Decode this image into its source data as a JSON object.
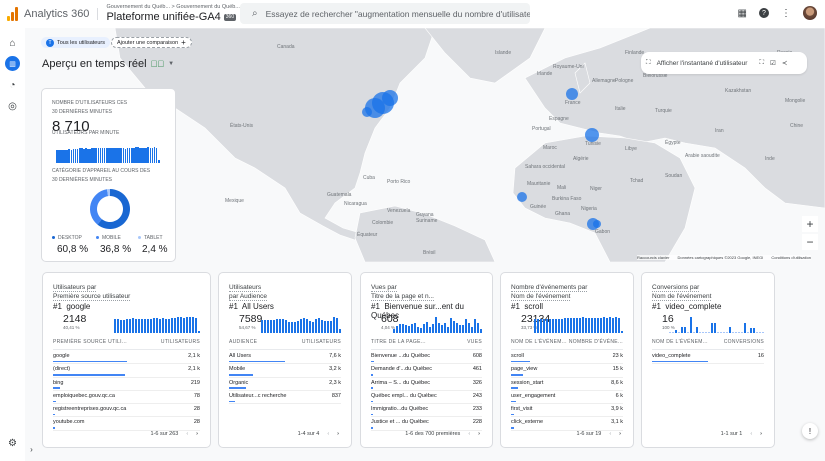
{
  "header": {
    "app_name": "Analytics 360",
    "breadcrumb": "Gouvernement du Québ... > Gouvernement du Québ...",
    "property": "Plateforme unifiée-GA4",
    "property_badge": "360",
    "search_placeholder": "Essayez de rechercher \"augmentation mensuelle du nombre d'utilisateurs..."
  },
  "filters": {
    "segment_badge": "T",
    "segment": "Tous les utilisateurs",
    "add_comparison": "Ajouter une comparaison"
  },
  "page_title": "Aperçu en temps réel",
  "map": {
    "snapshot_label": "Afficher l'instantané d'utilisateur",
    "zoom_in": "+",
    "zoom_out": "−",
    "attribution": [
      "Raccourcis clavier",
      "Données cartographiques ©2023 Google, INEGI",
      "Conditions d'utilisation"
    ],
    "labels": [
      "Canada",
      "États-Unis",
      "Mexique",
      "Cuba",
      "Porto Rico",
      "Guatemala",
      "Nicaragua",
      "Venezuela",
      "Colombie",
      "Guyana",
      "Suriname",
      "Équateur",
      "Brésil",
      "Islande",
      "Royaume-Uni",
      "Irlande",
      "France",
      "Allemagne",
      "Espagne",
      "Portugal",
      "Italie",
      "Tunisie",
      "Maroc",
      "Algérie",
      "Sahara occidental",
      "Mauritanie",
      "Mali",
      "Niger",
      "Burkina Faso",
      "Guinée",
      "Ghana",
      "Nigeria",
      "Gabon",
      "Finlande",
      "Russie",
      "Pologne",
      "Biélorussie",
      "Égypte",
      "Libye",
      "Soudan",
      "Tchad",
      "Kazakhstan",
      "Chine",
      "Inde",
      "Arabie saoudite",
      "Iran",
      "Turquie",
      "Mongolie"
    ],
    "accent": "#1a73e8"
  },
  "realtime": {
    "users_label_1": "Nombre d'utilisateurs ces",
    "users_label_2": "30 dernières minutes",
    "users_value": "8 710",
    "per_minute_label": "Utilisateurs par minute",
    "per_minute": [
      18,
      18,
      19,
      19,
      18,
      19,
      20,
      19,
      20,
      20,
      20,
      21,
      21,
      20,
      21,
      20,
      20,
      21,
      21,
      22,
      22,
      22,
      21,
      21,
      22,
      21,
      22,
      22,
      21,
      22,
      21,
      22,
      21,
      20,
      21,
      22,
      21,
      21,
      23,
      23,
      22,
      22,
      22,
      21,
      23,
      22,
      22,
      23,
      22,
      4
    ],
    "device_label_1": "Catégorie d'appareil au cours des",
    "device_label_2": "30 dernières minutes",
    "devices": [
      {
        "name": "DESKTOP",
        "value": "60,8 %",
        "share": 60.8,
        "color": "#1967d2"
      },
      {
        "name": "MOBILE",
        "value": "36,8 %",
        "share": 36.8,
        "color": "#4285f4"
      },
      {
        "name": "TABLET",
        "value": "2,4 %",
        "share": 2.4,
        "color": "#a8c7fa"
      }
    ]
  },
  "cards": [
    {
      "title_1": "Utilisateurs par",
      "title_2": "Première source utilisateur",
      "rank": "#1",
      "top": "google",
      "value": "2148",
      "pct": "40,41 %",
      "col1": "PREMIÈRE SOURCE UTILI...",
      "col2": "UTILISATEURS",
      "spark": [
        14,
        14,
        13,
        13,
        14,
        14,
        15,
        14,
        14,
        14,
        14,
        14,
        14,
        15,
        15,
        14,
        15,
        14,
        14,
        15,
        15,
        16,
        16,
        15,
        16,
        16,
        16,
        15,
        2
      ],
      "rows": [
        {
          "name": "google",
          "value": "2,1 k",
          "share": 1.0
        },
        {
          "name": "(direct)",
          "value": "2,1 k",
          "share": 0.98
        },
        {
          "name": "bing",
          "value": "219",
          "share": 0.1
        },
        {
          "name": "emploiquebec.gouv.qc.ca",
          "value": "78",
          "share": 0.04
        },
        {
          "name": "registreentreprises.gouv.qc.ca",
          "value": "28",
          "share": 0.015
        },
        {
          "name": "youtube.com",
          "value": "28",
          "share": 0.015
        }
      ],
      "pager": "1-6 sur 263"
    },
    {
      "title_1": "Utilisateurs",
      "title_2": "par Audience",
      "rank": "#1",
      "top": "All Users",
      "value": "7589",
      "pct": "54,67 %",
      "col1": "AUDIENCE",
      "col2": "UTILISATEURS",
      "spark": [
        14,
        14,
        14,
        14,
        14,
        15,
        15,
        15,
        14,
        12,
        12,
        12,
        13,
        15,
        16,
        15,
        13,
        12,
        15,
        16,
        14,
        13,
        13,
        13,
        17,
        16,
        4
      ],
      "rows": [
        {
          "name": "All Users",
          "value": "7,6 k",
          "share": 1.0
        },
        {
          "name": "Mobile",
          "value": "3,2 k",
          "share": 0.42
        },
        {
          "name": "Organic",
          "value": "2,3 k",
          "share": 0.3
        },
        {
          "name": "Utilisateur...c recherche",
          "value": "837",
          "share": 0.11
        }
      ],
      "pager": "1-4 sur 4"
    },
    {
      "title_1": "Vues par",
      "title_2": "Titre de la page et n...",
      "rank": "#1",
      "top": "Bienvenue sur...ent du Québec",
      "value": "608",
      "pct": "4,04 %",
      "col1": "TITRE DE LA PAGE...",
      "col2": "VUES",
      "spark": [
        4,
        7,
        9,
        9,
        8,
        7,
        9,
        10,
        6,
        5,
        9,
        11,
        6,
        9,
        16,
        10,
        8,
        10,
        6,
        15,
        12,
        10,
        8,
        8,
        14,
        10,
        6,
        14,
        10,
        4
      ],
      "rows": [
        {
          "name": "Bienvenue ...du Québec",
          "value": "608",
          "share": 0.05
        },
        {
          "name": "Demande d'...du Québec",
          "value": "461",
          "share": 0.04
        },
        {
          "name": "Arrima – S... du Québec",
          "value": "326",
          "share": 0.03
        },
        {
          "name": "Québec empl... du Québec",
          "value": "243",
          "share": 0.02
        },
        {
          "name": "Immigratio...du Québec",
          "value": "233",
          "share": 0.02
        },
        {
          "name": "Justice et ... du Québec",
          "value": "228",
          "share": 0.02
        }
      ],
      "pager": "1-6 des 700 premières"
    },
    {
      "title_1": "Nombre d'événements par",
      "title_2": "Nom de l'événement",
      "rank": "#1",
      "top": "scroll",
      "value": "23134",
      "pct": "33,73 %",
      "col1": "NOM DE L'ÉVÉNEM...",
      "col2": "NOMBRE D'ÉVÉNE...",
      "spark": [
        14,
        14,
        14,
        14,
        14,
        14,
        14,
        14,
        14,
        14,
        15,
        15,
        15,
        15,
        15,
        15,
        16,
        15,
        15,
        15,
        15,
        15,
        15,
        16,
        15,
        16,
        15,
        16,
        15,
        2
      ],
      "rows": [
        {
          "name": "scroll",
          "value": "23 k",
          "share": 0.34
        },
        {
          "name": "page_view",
          "value": "15 k",
          "share": 0.22
        },
        {
          "name": "session_start",
          "value": "8,6 k",
          "share": 0.13
        },
        {
          "name": "user_engagement",
          "value": "6 k",
          "share": 0.09
        },
        {
          "name": "first_visit",
          "value": "3,9 k",
          "share": 0.06
        },
        {
          "name": "click_externe",
          "value": "3,1 k",
          "share": 0.05
        }
      ],
      "pager": "1-6 sur 19"
    },
    {
      "title_1": "Conversions par",
      "title_2": "Nom de l'événement",
      "rank": "#1",
      "top": "video_complete",
      "value": "16",
      "pct": "100 %",
      "col1": "NOM DE L'ÉVÉNEM...",
      "col2": "CONVERSIONS",
      "spark": [
        0,
        0,
        3,
        0,
        5,
        5,
        0,
        14,
        0,
        5,
        0,
        0,
        0,
        0,
        9,
        9,
        0,
        0,
        0,
        0,
        5,
        0,
        0,
        0,
        0,
        9,
        0,
        4,
        4,
        0,
        0,
        0
      ],
      "rows": [
        {
          "name": "video_complete",
          "value": "16",
          "share": 1.0
        }
      ],
      "pager": "1-1 sur 1"
    }
  ]
}
